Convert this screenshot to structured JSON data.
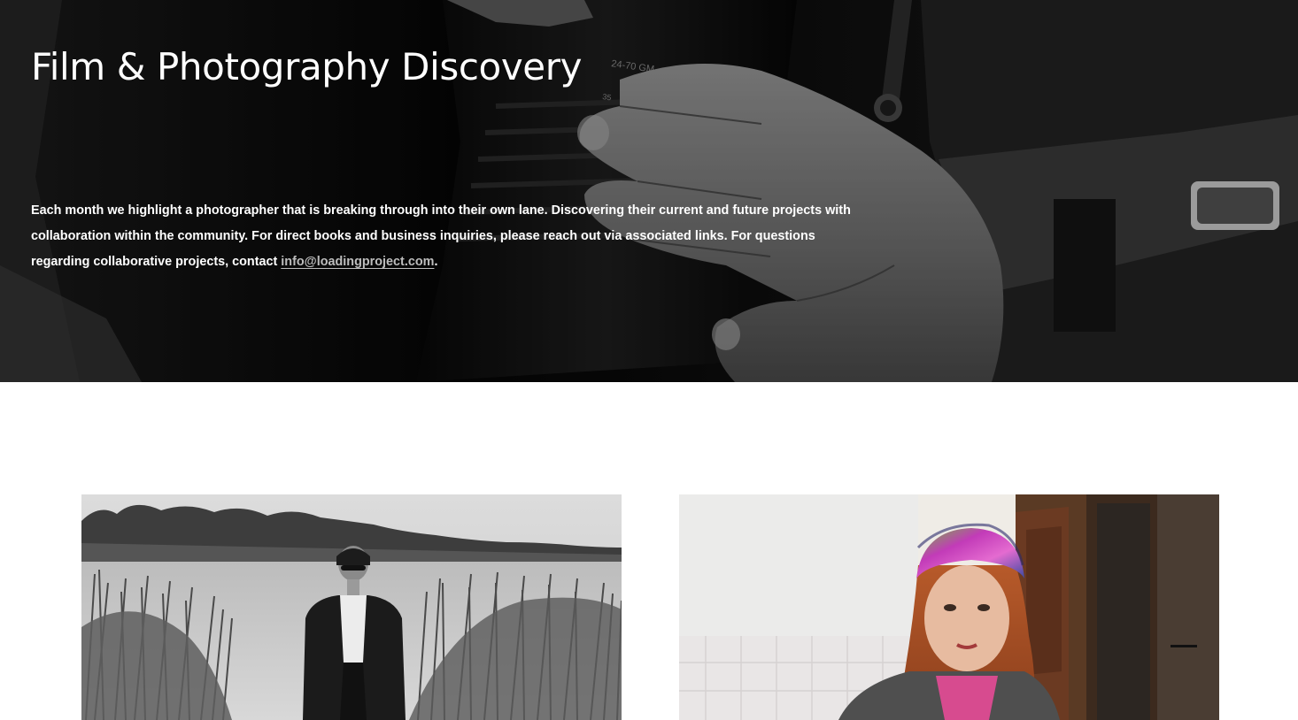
{
  "hero": {
    "title": "Film & Photography Discovery",
    "description_before_link": "Each month we highlight a photographer that is breaking through into their own lane. Discovering their current and future projects with collaboration within the community. For direct books and business inquiries, please reach out via associated links. For questions regarding collaborative projects, contact ",
    "email_link": "info@loadingproject.com",
    "description_after_link": ".",
    "background_image": "black-and-white photo of hands holding a camera lens",
    "lens_markings": [
      "24-70 GM",
      "35"
    ],
    "colors": {
      "text": "#ffffff",
      "link": "#bdbdbd",
      "background": "#0b0b0b"
    }
  },
  "gallery": {
    "cards": [
      {
        "image": "black-and-white portrait of a woman in sunglasses and a blazer standing among reeds by a lake"
      },
      {
        "image": "color portrait of a red-haired woman wearing a tie-dye head scarf in a kitchen doorway"
      }
    ]
  }
}
